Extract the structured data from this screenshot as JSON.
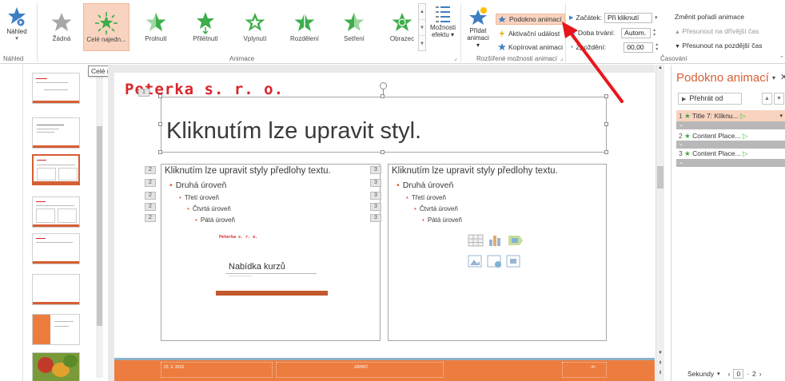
{
  "ribbon": {
    "preview": {
      "label": "Náhled",
      "group_label": "Náhled"
    },
    "animation_group_label": "Animace",
    "effects": [
      {
        "label": "Žádná",
        "icon": "star-gray-icon"
      },
      {
        "label": "Celé najedn...",
        "icon": "star-burst-icon",
        "selected": true
      },
      {
        "label": "Prolnutí",
        "icon": "star-fade-icon"
      },
      {
        "label": "Přilétnutí",
        "icon": "star-fly-icon"
      },
      {
        "label": "Vplynutí",
        "icon": "star-float-icon"
      },
      {
        "label": "Rozdělení",
        "icon": "star-split-icon"
      },
      {
        "label": "Setření",
        "icon": "star-wipe-icon"
      },
      {
        "label": "Obrazec",
        "icon": "star-shape-icon"
      }
    ],
    "effect_options": {
      "line1": "Možnosti",
      "line2": "efektu ▾"
    },
    "add_animation": {
      "line1": "Přidat",
      "line2": "animaci ▾"
    },
    "advanced": {
      "group_label": "Rozšířené možnosti animací",
      "animation_pane": "Podokno animací",
      "trigger": "Aktivační událost",
      "copy_animation": "Kopírovat animaci"
    },
    "timing": {
      "group_label": "Časování",
      "start_label": "Začátek:",
      "start_value": "Při kliknutí",
      "duration_label": "Doba trvání:",
      "duration_value": "Autom.",
      "delay_label": "Zpoždění:",
      "delay_value": "00,00",
      "reorder_label": "Změnit pořadí animace",
      "move_earlier": "Přesunout na dřívější čas",
      "move_later": "Přesunout na pozdější čas"
    }
  },
  "tooltip": "Celé najednou",
  "slide": {
    "company": "Peterka s. r. o.",
    "title": "Kliknutím lze upravit styl.",
    "left_box": {
      "level1": "Kliknutím lze upravit styly předlohy textu.",
      "level2": "Druhá úroveň",
      "level3": "Třetí úroveň",
      "level4": "Čtvrtá úroveň",
      "level5": "Pátá úroveň",
      "tags": [
        "2",
        "2",
        "2",
        "2",
        "2"
      ],
      "mini_logo": "Peterka s. r. o.",
      "offer": "Nabídka kurzů"
    },
    "right_box": {
      "level1": "Kliknutím lze upravit styly předlohy textu.",
      "level2": "Druhá úroveň",
      "level3": "Třetí úroveň",
      "level4": "Čtvrtá úroveň",
      "level5": "Pátá úroveň",
      "tags": [
        "3",
        "3",
        "3",
        "3",
        "3"
      ]
    },
    "title_tag": "1",
    "footer": {
      "date": "22. 3. 2015",
      "center": "ZÁPATÍ",
      "number": "‹#›"
    }
  },
  "anim_pane": {
    "title": "Podokno animací",
    "play_from": "Přehrát od",
    "items": [
      {
        "num": "1",
        "label": "Title 7: Kliknu...",
        "selected": true
      },
      {
        "num": "2",
        "label": "Content Place...",
        "selected": false
      },
      {
        "num": "3",
        "label": "Content Place...",
        "selected": false
      }
    ],
    "group_chevron": "⌄",
    "bottom_label": "Sekundy",
    "bottom_value1": "0",
    "bottom_value2": "2"
  },
  "colors": {
    "accent": "#d55f33",
    "selected_bg": "#f8d3bf",
    "logo_red": "#d8252c",
    "footer_orange": "#ec7d3f",
    "arrow_red": "#e8161c"
  }
}
